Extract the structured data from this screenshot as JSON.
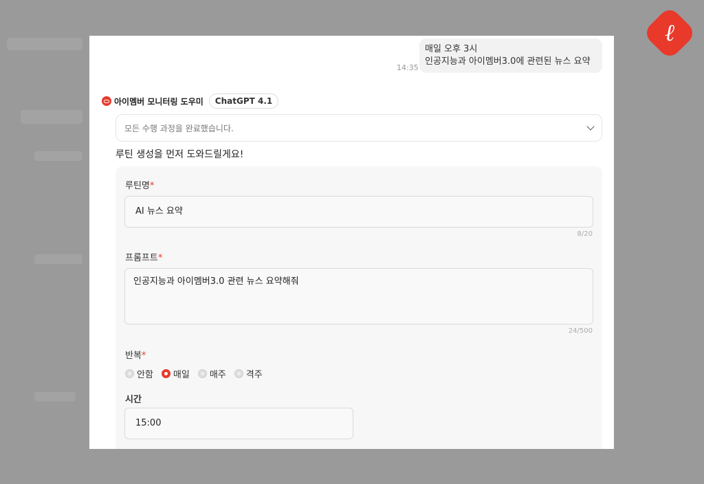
{
  "chat": {
    "user_message_line1": "매일 오후 3시",
    "user_message_line2": "인공지능과 아이멤버3.0에 관련된 뉴스 요약",
    "user_message_time": "14:35",
    "bot_name": "아이멤버 모니터링 도우미",
    "model_badge": "ChatGPT 4.1",
    "status_text": "모든 수행 과정을 완료했습니다.",
    "intro_text": "루틴 생성을 먼저 도와드릴게요!"
  },
  "form": {
    "routine_name_label": "루틴명",
    "routine_name_value": "AI 뉴스 요약",
    "routine_name_counter": "8/20",
    "prompt_label": "프롬프트",
    "prompt_value": "인공지능과 아이멤버3.0 관련 뉴스 요약해줘",
    "prompt_counter": "24/500",
    "repeat_label": "반복",
    "repeat_options": [
      {
        "label": "안함",
        "selected": false
      },
      {
        "label": "매일",
        "selected": true
      },
      {
        "label": "매주",
        "selected": false
      },
      {
        "label": "격주",
        "selected": false
      }
    ],
    "time_label": "시간",
    "time_value": "15:00",
    "required_mark": "*"
  },
  "colors": {
    "accent": "#e8392b",
    "backdrop": "#9a9a9a"
  },
  "icons": {
    "bot_avatar": "bot-avatar-icon",
    "expand": "chevron-down-icon",
    "brand": "brand-logo-icon"
  }
}
